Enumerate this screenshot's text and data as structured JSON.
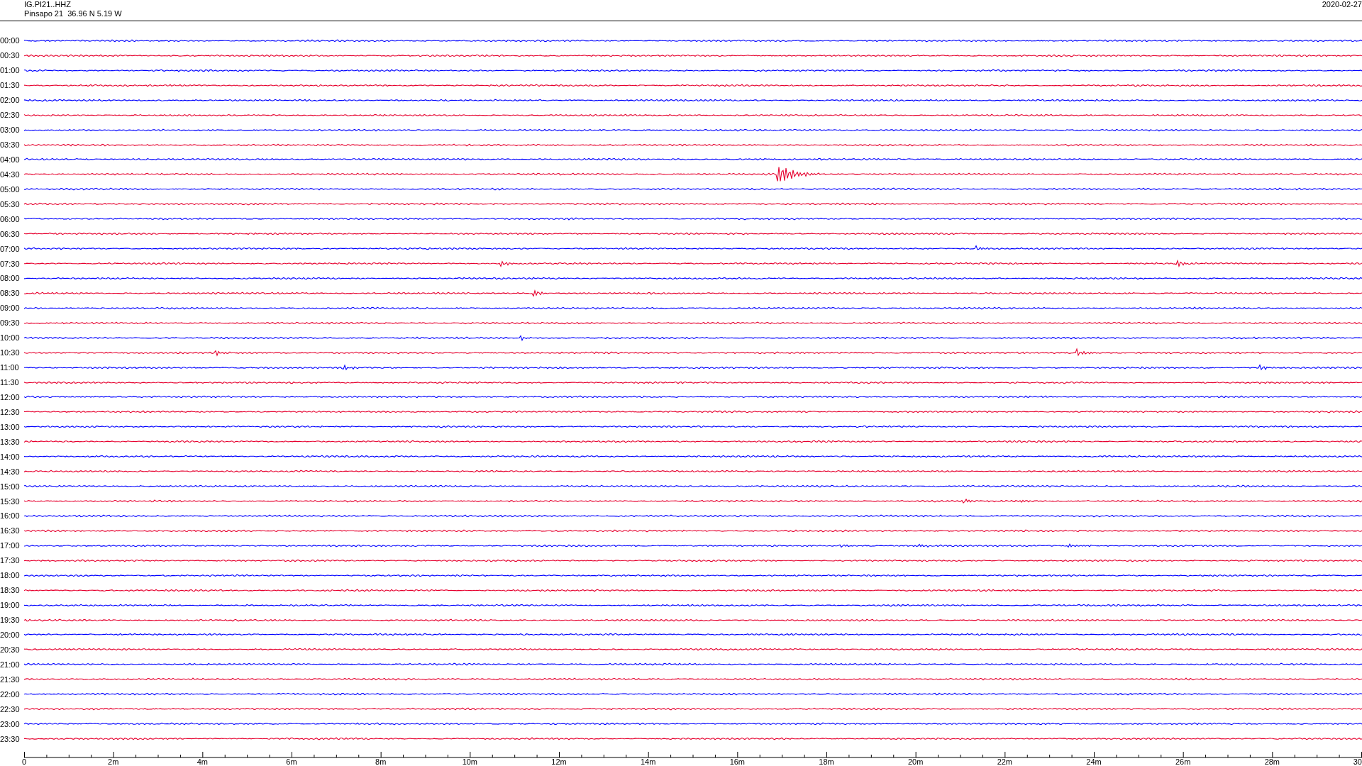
{
  "header": {
    "channel": "IG.PI21..HHZ",
    "station": "Pinsapo 21  36.96 N 5.19 W",
    "date": "2020-02-27"
  },
  "rows": [
    {
      "label": "00:00",
      "color": "#0000ff"
    },
    {
      "label": "00:30",
      "color": "#e6002e"
    },
    {
      "label": "01:00",
      "color": "#0000ff"
    },
    {
      "label": "01:30",
      "color": "#e6002e"
    },
    {
      "label": "02:00",
      "color": "#0000ff"
    },
    {
      "label": "02:30",
      "color": "#e6002e"
    },
    {
      "label": "03:00",
      "color": "#0000ff"
    },
    {
      "label": "03:30",
      "color": "#e6002e"
    },
    {
      "label": "04:00",
      "color": "#0000ff"
    },
    {
      "label": "04:30",
      "color": "#e6002e"
    },
    {
      "label": "05:00",
      "color": "#0000ff"
    },
    {
      "label": "05:30",
      "color": "#e6002e"
    },
    {
      "label": "06:00",
      "color": "#0000ff"
    },
    {
      "label": "06:30",
      "color": "#e6002e"
    },
    {
      "label": "07:00",
      "color": "#0000ff"
    },
    {
      "label": "07:30",
      "color": "#e6002e"
    },
    {
      "label": "08:00",
      "color": "#0000ff"
    },
    {
      "label": "08:30",
      "color": "#e6002e"
    },
    {
      "label": "09:00",
      "color": "#0000ff"
    },
    {
      "label": "09:30",
      "color": "#e6002e"
    },
    {
      "label": "10:00",
      "color": "#0000ff"
    },
    {
      "label": "10:30",
      "color": "#e6002e"
    },
    {
      "label": "11:00",
      "color": "#0000ff"
    },
    {
      "label": "11:30",
      "color": "#e6002e"
    },
    {
      "label": "12:00",
      "color": "#0000ff"
    },
    {
      "label": "12:30",
      "color": "#e6002e"
    },
    {
      "label": "13:00",
      "color": "#0000ff"
    },
    {
      "label": "13:30",
      "color": "#e6002e"
    },
    {
      "label": "14:00",
      "color": "#0000ff"
    },
    {
      "label": "14:30",
      "color": "#e6002e"
    },
    {
      "label": "15:00",
      "color": "#0000ff"
    },
    {
      "label": "15:30",
      "color": "#e6002e"
    },
    {
      "label": "16:00",
      "color": "#0000ff"
    },
    {
      "label": "16:30",
      "color": "#e6002e"
    },
    {
      "label": "17:00",
      "color": "#0000ff"
    },
    {
      "label": "17:30",
      "color": "#e6002e"
    },
    {
      "label": "18:00",
      "color": "#0000ff"
    },
    {
      "label": "18:30",
      "color": "#e6002e"
    },
    {
      "label": "19:00",
      "color": "#0000ff"
    },
    {
      "label": "19:30",
      "color": "#e6002e"
    },
    {
      "label": "20:00",
      "color": "#0000ff"
    },
    {
      "label": "20:30",
      "color": "#e6002e"
    },
    {
      "label": "21:00",
      "color": "#0000ff"
    },
    {
      "label": "21:30",
      "color": "#e6002e"
    },
    {
      "label": "22:00",
      "color": "#0000ff"
    },
    {
      "label": "22:30",
      "color": "#e6002e"
    },
    {
      "label": "23:00",
      "color": "#0000ff"
    },
    {
      "label": "23:30",
      "color": "#e6002e"
    }
  ],
  "time_axis": {
    "labels": [
      "0",
      "2m",
      "4m",
      "6m",
      "8m",
      "10m",
      "12m",
      "14m",
      "16m",
      "18m",
      "20m",
      "22m",
      "24m",
      "26m",
      "28m",
      "30"
    ]
  }
}
